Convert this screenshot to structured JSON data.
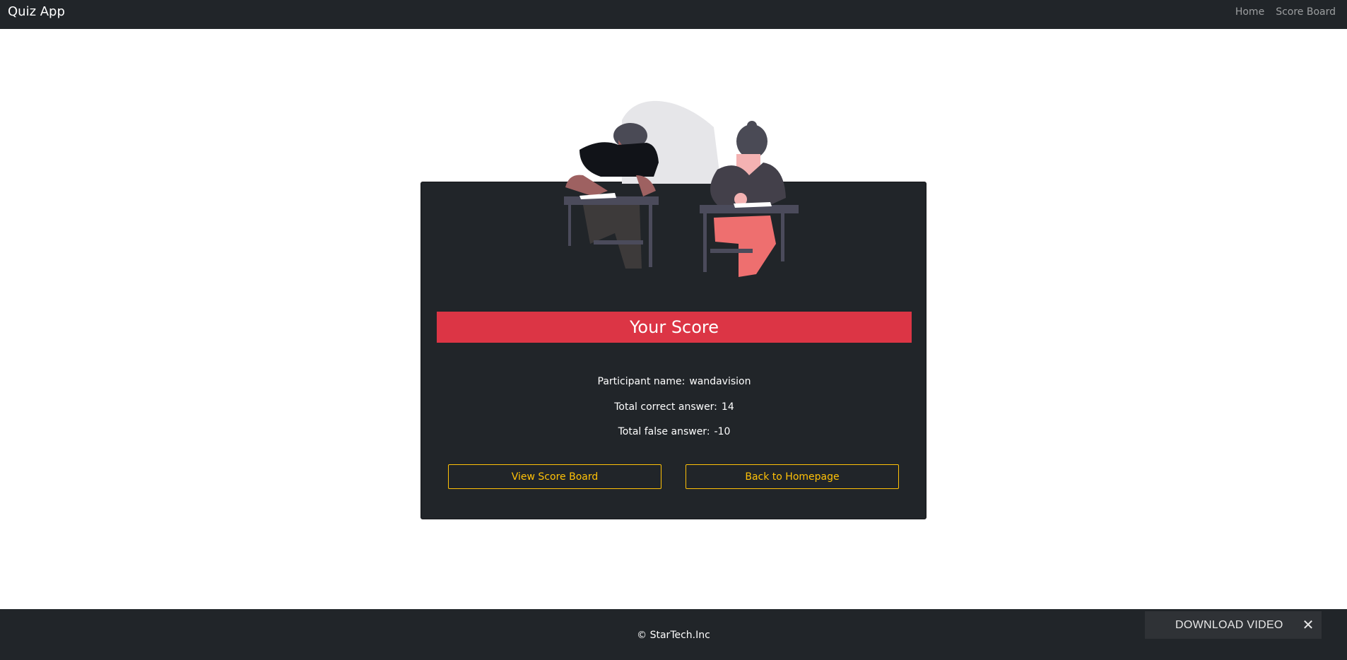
{
  "navbar": {
    "brand": "Quiz App",
    "links": [
      "Home",
      "Score Board"
    ]
  },
  "card": {
    "title": "Your Score",
    "participant_label": "Participant name:",
    "participant_value": "wandavision",
    "correct_label": "Total correct answer:",
    "correct_value": "14",
    "false_label": "Total false answer:",
    "false_value": "-10",
    "view_button": "View Score Board",
    "home_button": "Back to Homepage"
  },
  "footer": {
    "copyright": "© StarTech.Inc"
  },
  "popup": {
    "label": "DOWNLOAD VIDEO",
    "close_icon": "close-icon"
  },
  "colors": {
    "navbar": "#212529",
    "accent_red": "#dc3545",
    "button_yellow": "#ffc107"
  }
}
